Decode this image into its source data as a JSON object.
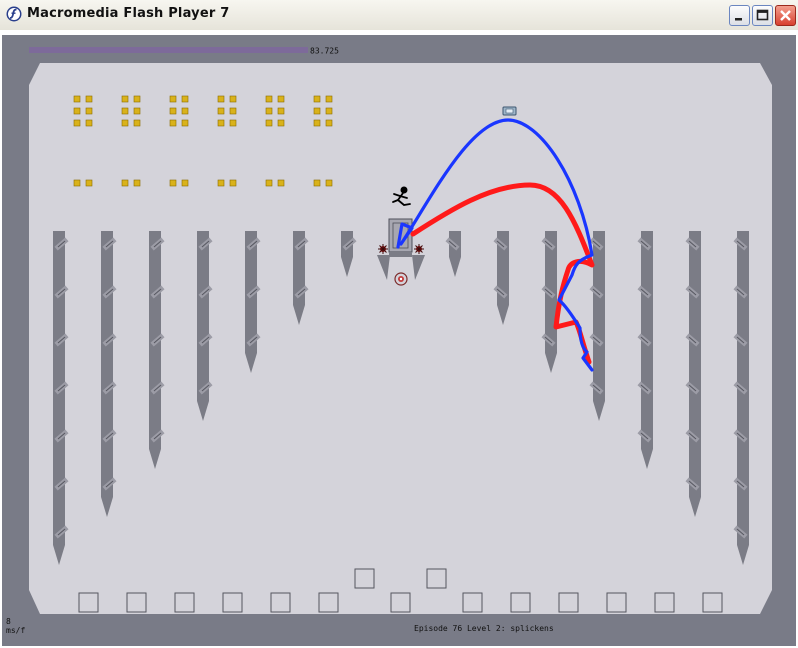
{
  "window": {
    "title": "Macromedia Flash Player 7",
    "icon": "flash-icon",
    "buttons": [
      "minimize-icon",
      "maximize-icon",
      "close-icon"
    ]
  },
  "hud": {
    "time_remaining": "83.725",
    "time_fraction": 0.82,
    "stats_line1": "8",
    "stats_line2": "ms/f",
    "episode_label": "Episode 76 Level 2: splickens"
  },
  "colors": {
    "frame": "#797b87",
    "floor": "#d4d3da",
    "wall": "#7b7c86",
    "gold": "#d9b21a",
    "time_bar": "#7d6a9a",
    "path_red": "#ff1a1a",
    "path_blue": "#1a36ff"
  },
  "entities": {
    "player": "ninja-stick-figure",
    "exit_switch": "switch-icon",
    "exit_door": "exit-door",
    "mines": "mine-icon",
    "turret": "turret-icon"
  }
}
